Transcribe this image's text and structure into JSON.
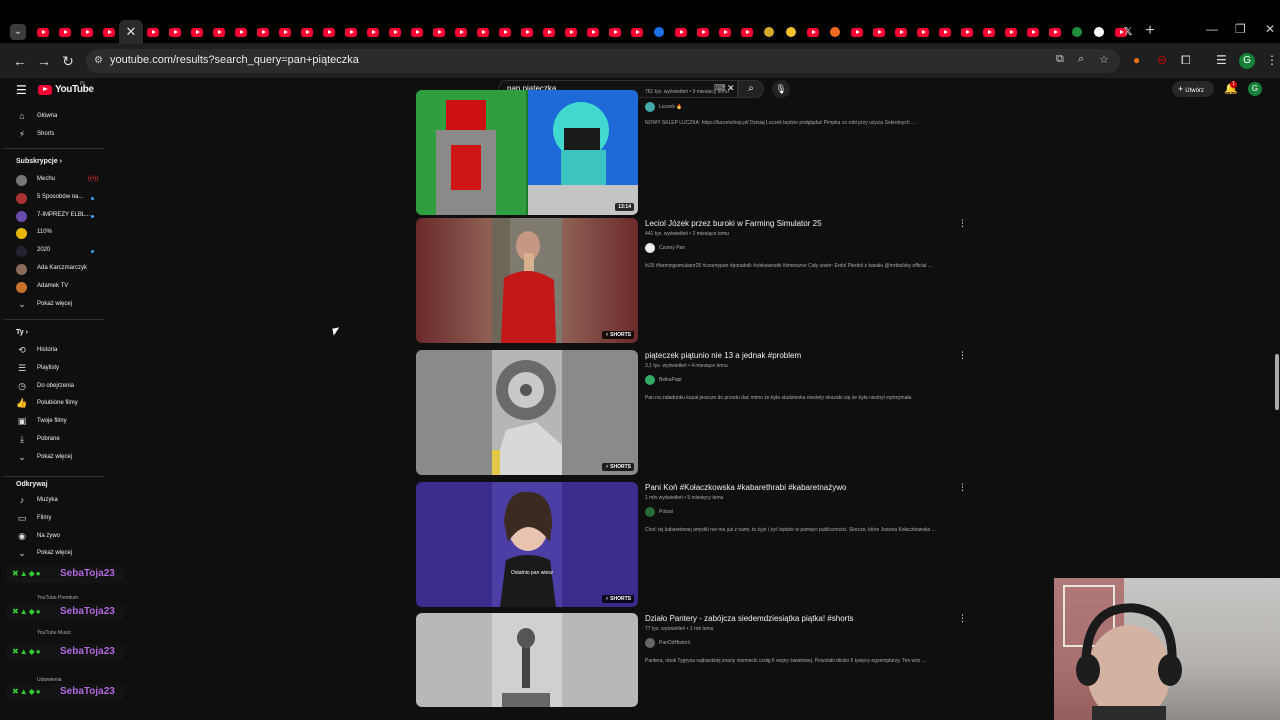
{
  "browser": {
    "url": "youtube.com/results?search_query=pan+piąteczka",
    "tab_count_visible": 46
  },
  "youtube": {
    "logo_text": "YouTube",
    "region": "PL",
    "search_query": "pan piąteczka",
    "create_label": "Utwórz",
    "notification_count": "1",
    "avatar_letter": "G"
  },
  "sidebar": {
    "main": [
      {
        "label": "Główna",
        "icon": "home-icon"
      },
      {
        "label": "Shorts",
        "icon": "shorts-icon"
      }
    ],
    "subs_header": "Subskrypcje",
    "subs": [
      {
        "label": "Mechu",
        "color": "#777"
      },
      {
        "label": "5 Sposobów na...",
        "color": "#a33"
      },
      {
        "label": "7-IMPREZY ELBL...",
        "color": "#6a4aa8"
      },
      {
        "label": "110%",
        "color": "#e8b800"
      },
      {
        "label": "2020",
        "color": "#223"
      },
      {
        "label": "Ada Karczmarczyk",
        "color": "#8b6b5a"
      },
      {
        "label": "Adamek TV",
        "color": "#c9722e"
      }
    ],
    "show_more": "Pokaż więcej",
    "you_header": "Ty",
    "you": [
      {
        "label": "Historia",
        "icon": "history-icon"
      },
      {
        "label": "Playlisty",
        "icon": "playlist-icon"
      },
      {
        "label": "Do obejrzenia",
        "icon": "watch-later-icon"
      },
      {
        "label": "Polubione filmy",
        "icon": "like-icon"
      },
      {
        "label": "Twoje filmy",
        "icon": "your-videos-icon"
      },
      {
        "label": "Pobrane",
        "icon": "download-icon"
      },
      {
        "label": "Pokaż więcej",
        "icon": "chevron-down-icon"
      }
    ],
    "explore_header": "Odkrywaj",
    "explore": [
      {
        "label": "Muzyka",
        "icon": "music-icon"
      },
      {
        "label": "Filmy",
        "icon": "movies-icon"
      },
      {
        "label": "Na żywo",
        "icon": "live-icon"
      },
      {
        "label": "Pokaż więcej",
        "icon": "chevron-down-icon"
      }
    ],
    "below_overlay": [
      "Więcej z YouTube",
      "YouTube Premium",
      "YouTube Music",
      "Ustawienia"
    ]
  },
  "results": [
    {
      "title": "",
      "meta": "761 tys. wyświetleń • 9 miesięcy temu",
      "channel": "Luczek 🔥",
      "desc": "NOWY SKLEP LUCZKA: https://luczekshop.pl/ Dzisiaj Luczek będzie podglądać Pimpka co robi przy użyciu Sekretnych ...",
      "badge": "13:14",
      "avatar_color": "#4aa"
    },
    {
      "title": "Leciol Józek przez buroki w Farming Simulator 25",
      "meta": "441 tys. wyświetleń • 2 miesiące temu",
      "channel": "Czarny Pan",
      "desc": "fs25 #farmingsimulator25 #czarnypan #poradnik #ciekawostki #śmieszne Cały utwór: Erdol Pierdol z kanału @mrtbulsky official ...",
      "badge": "SHORTS",
      "avatar_color": "#eee"
    },
    {
      "title": "piąteczek piątunio nie 13 a jednak #problem",
      "meta": "3,1 tys. wyświetleń • 4 miesiące temu",
      "channel": "BelkaPapi",
      "desc": "Pan na załadunku kazał jeszcze do przodu dać mimo że była studzienka niestety okazało się że była niezbyt wytrzymała.",
      "badge": "SHORTS",
      "avatar_color": "#3a6"
    },
    {
      "title": "Pani Koń #Kołaczkowska #kabarethrabi #kabaretnażywo",
      "meta": "1 mln wyświetleń • 5 miesięcy temu",
      "channel": "Polsat",
      "desc": "Choć tej kabaretowej artystki nie ma już z nami, to żyje i żyć będzie w pamięci publiczności. Skecze, które Joanna Kołaczkowska ...",
      "badge": "SHORTS",
      "avatar_color": "#2a6a3a"
    },
    {
      "title": "Działo Pantery - zabójcza siedemdziesiątka piątka! #shorts",
      "meta": "77 tys. wyświetleń • 1 rok temu",
      "channel": "PanOdHistorii",
      "desc": "Pantera, obok Tygrysa najbardziej znany niemiecki czołg II wojny światowej. Powstało blisko 6 tysięcy egzemplarzy. Ten wóz ...",
      "badge": "",
      "avatar_color": "#666"
    }
  ],
  "chat": {
    "nick": "SebaToja23"
  }
}
